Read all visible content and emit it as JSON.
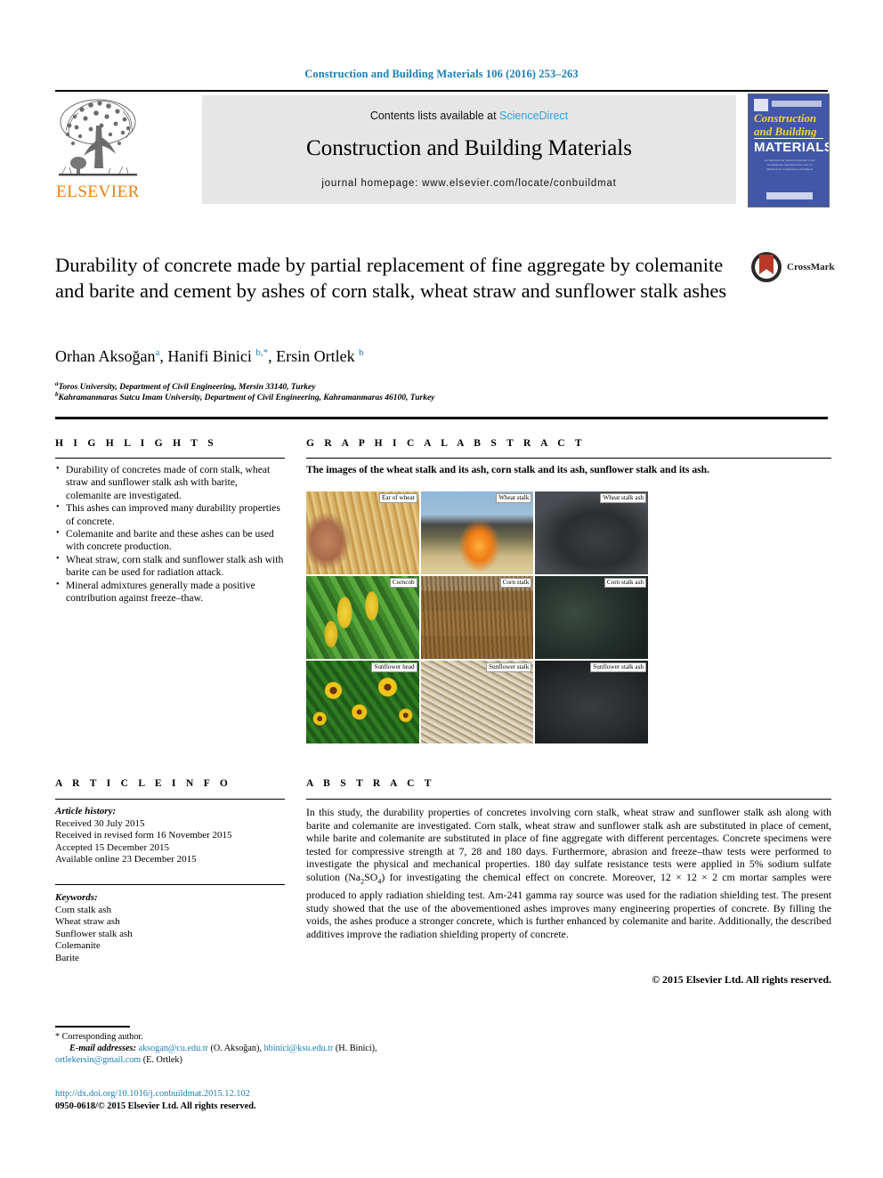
{
  "running_head": "Construction and Building Materials 106 (2016) 253–263",
  "masthead": {
    "publisher": "ELSEVIER",
    "contents_prefix": "Contents lists available at ",
    "contents_link": "ScienceDirect",
    "journal_title": "Construction and Building Materials",
    "homepage": "journal homepage: www.elsevier.com/locate/conbuildmat",
    "cover": {
      "line1": "Construction",
      "line2": "and Building",
      "line3": "MATERIALS",
      "blurb": "An International Journal dedicated to the Investigation and Innovative Use of Materials in Construction and Repair"
    },
    "link_color": "#2da2d8"
  },
  "article": {
    "title": "Durability of concrete made by partial replacement of fine aggregate by colemanite and barite and cement by ashes of corn stalk, wheat straw and sunflower stalk ashes",
    "crossmark_label": "CrossMark",
    "authors_html": "Orhan Aksoğan<sup>a</sup>, Hanifi Binici <sup>b,*</sup>, Ersin Ortlek <sup>b</sup>",
    "affiliations": [
      "Toros University, Department of Civil Engineering, Mersin 33140, Turkey",
      "Kahramanmaras Sutcu Imam University, Department of Civil Engineering, Kahramanmaras 46100, Turkey"
    ],
    "affiliation_marks": [
      "a",
      "b"
    ]
  },
  "highlights": {
    "heading": "H I G H L I G H T S",
    "items": [
      "Durability of concretes made of corn stalk, wheat straw and sunflower stalk ash with barite, colemanite are investigated.",
      "This ashes can improved many durability properties of concrete.",
      "Colemanite and barite and these ashes can be used with concrete production.",
      "Wheat straw, corn stalk and sunflower stalk ash with barite can be used for radiation attack.",
      "Mineral admixtures generally made a positive contribution against freeze–thaw."
    ]
  },
  "graphical_abstract": {
    "heading": "G R A P H I C A L   A B S T R A C T",
    "caption": "The images of the wheat stalk and its ash, corn stalk and its ash, sunflower stalk and its ash.",
    "images": [
      {
        "label": "Ear of wheat",
        "kind": "wheatfield"
      },
      {
        "label": "Wheat stalk",
        "kind": "burnfield"
      },
      {
        "label": "Wheat stalk ash",
        "kind": "ash"
      },
      {
        "label": "Corncob",
        "kind": "corncob"
      },
      {
        "label": "Corn stalk",
        "kind": "cornstalk"
      },
      {
        "label": "Corn stalk ash",
        "kind": "cornash"
      },
      {
        "label": "Sunflower head",
        "kind": "sunflowers"
      },
      {
        "label": "Sunflower stalk",
        "kind": "sunstalk"
      },
      {
        "label": "Sunflower stalk ash",
        "kind": "sunash"
      }
    ]
  },
  "article_info": {
    "heading": "A R T I C L E   I N F O",
    "history_label": "Article history:",
    "history": [
      "Received 30 July 2015",
      "Received in revised form 16 November 2015",
      "Accepted 15 December 2015",
      "Available online 23 December 2015"
    ],
    "keywords_label": "Keywords:",
    "keywords": [
      "Corn stalk ash",
      "Wheat straw ash",
      "Sunflower stalk ash",
      "Colemanite",
      "Barite"
    ]
  },
  "abstract": {
    "heading": "A B S T R A C T",
    "text_html": "In this study, the durability properties of concretes involving corn stalk, wheat straw and sunflower stalk ash along with barite and colemanite are investigated. Corn stalk, wheat straw and sunflower stalk ash are substituted in place of cement, while barite and colemanite are substituted in place of fine aggregate with different percentages. Concrete specimens were tested for compressive strength at 7, 28 and 180 days. Furthermore, abrasion and freeze–thaw tests were performed to investigate the physical and mechanical properties. 180 day sulfate resistance tests were applied in 5% sodium sulfate solution (Na<sub>2</sub>SO<sub>4</sub>) for investigating the chemical effect on concrete. Moreover, 12 × 12 × 2 cm mortar samples were produced to apply radiation shielding test. Am-241 gamma ray source was used for the radiation shielding test. The present study showed that the use of the abovementioned ashes improves many engineering properties of concrete. By filling the voids, the ashes produce a stronger concrete, which is further enhanced by colemanite and barite. Additionally, the described additives improve the radiation shielding property of concrete.",
    "copyright": "© 2015 Elsevier Ltd. All rights reserved."
  },
  "footer": {
    "corresponding": "* Corresponding author.",
    "email_label": "E-mail addresses:",
    "emails": [
      {
        "address": "aksogan@cu.edu.tr",
        "person": "(O. Aksoğan)"
      },
      {
        "address": "hbinici@ksu.edu.tr",
        "person": "(H. Binici)"
      },
      {
        "address": "ortlekersin@gmail.com",
        "person": "(E. Ortlek)"
      }
    ],
    "doi": "http://dx.doi.org/10.1016/j.conbuildmat.2015.12.102",
    "issn_line": "0950-0618/© 2015 Elsevier Ltd. All rights reserved."
  }
}
